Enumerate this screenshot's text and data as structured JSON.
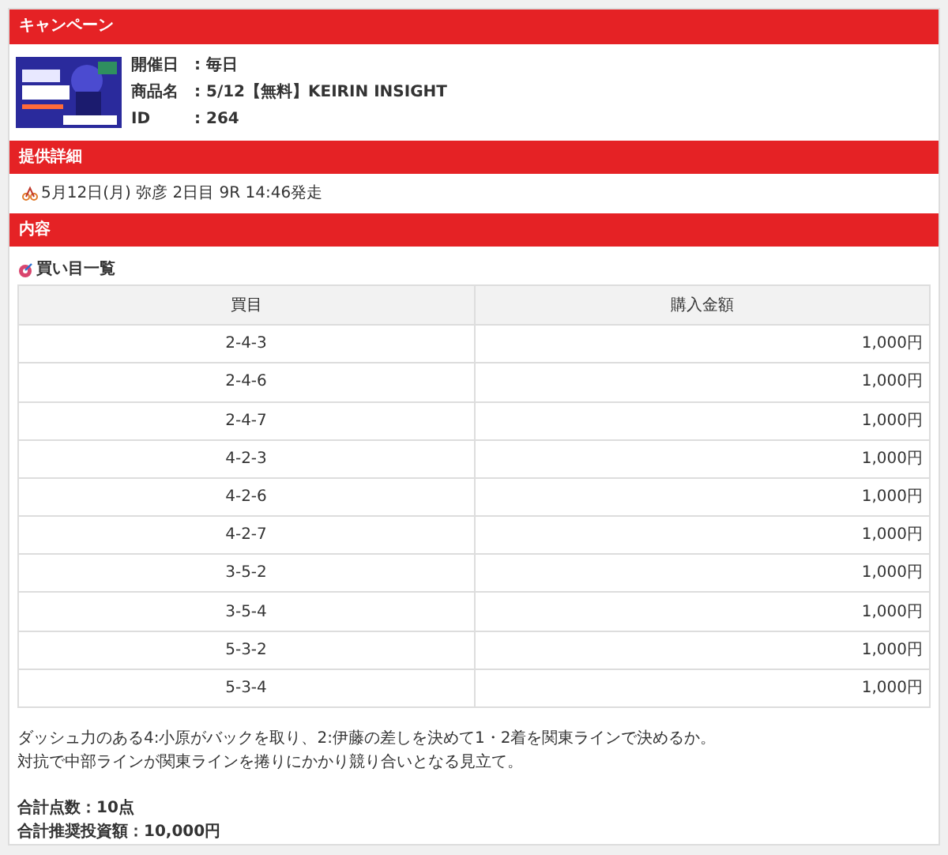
{
  "campaign": {
    "title": "キャンペーン",
    "info": [
      {
        "label": "開催日",
        "value": ": 毎日"
      },
      {
        "label": "商品名",
        "value": ": 5/12【無料】KEIRIN INSIGHT"
      },
      {
        "label": "ID",
        "value": ": 264"
      }
    ]
  },
  "details": {
    "title": "提供詳細",
    "race": "5月12日(月) 弥彦 2日目 9R 14:46発走"
  },
  "content": {
    "title": "内容",
    "list_title": "買い目一覧",
    "table": {
      "columns": [
        "買目",
        "購入金額"
      ],
      "rows": [
        [
          "2-4-3",
          "1,000円"
        ],
        [
          "2-4-6",
          "1,000円"
        ],
        [
          "2-4-7",
          "1,000円"
        ],
        [
          "4-2-3",
          "1,000円"
        ],
        [
          "4-2-6",
          "1,000円"
        ],
        [
          "4-2-7",
          "1,000円"
        ],
        [
          "3-5-2",
          "1,000円"
        ],
        [
          "3-5-4",
          "1,000円"
        ],
        [
          "5-3-2",
          "1,000円"
        ],
        [
          "5-3-4",
          "1,000円"
        ]
      ]
    },
    "comment": [
      "ダッシュ力のある4:小原がバックを取り、2:伊藤の差しを決めて1・2着を関東ラインで決めるか。",
      "対抗で中部ラインが関東ラインを捲りにかかり競り合いとなる見立て。"
    ],
    "totals": [
      "合計点数：10点",
      "合計推奨投資額：10,000円"
    ]
  }
}
